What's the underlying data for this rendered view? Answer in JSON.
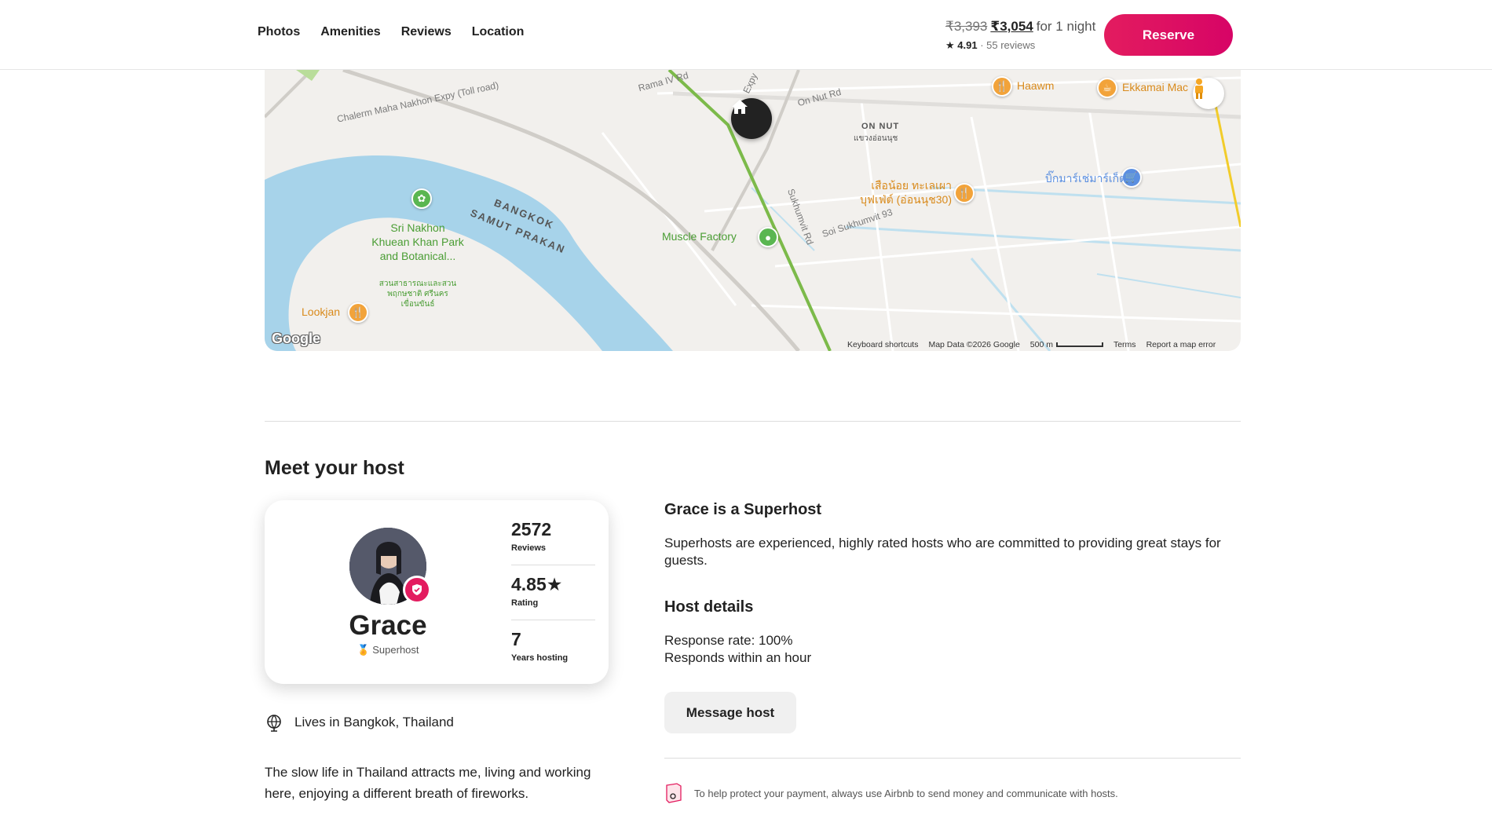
{
  "header": {
    "nav": [
      "Photos",
      "Amenities",
      "Reviews",
      "Location"
    ],
    "price_old": "₹3,393",
    "price_new": "₹3,054",
    "price_suffix": "for 1 night",
    "rating": "4.91",
    "rating_sep": " · ",
    "reviews_count": "55 reviews",
    "reserve_label": "Reserve",
    "brand_color": "#e31c5f"
  },
  "map": {
    "labels": {
      "haawm": "Haawm",
      "ekkamai": "Ekkamai Mac",
      "on_nut": "ON NUT",
      "on_nut_thai": "แขวงอ่อนนุช",
      "sri_nakhon": "Sri Nakhon Khuean Khan Park and Botanical...",
      "sri_nakhon_thai": "สวนสาธารณะและสวนพฤกษชาติ ศรีนครเขื่อนขันธ์",
      "bangkok": "BANGKOK",
      "samut": "SAMUT PRAKAN",
      "muscle": "Muscle Factory",
      "seafood": "เสือน้อย ทะเลเผา บุฟเฟ่ต์ (อ่อนนุช30)",
      "big_c": "บิ๊กมาร์เช่มาร์เก็ต",
      "lookjan": "Lookjan",
      "rama": "Rama IV Rd",
      "chalerm": "Chalerm Maha Nakhon Expy (Toll road)",
      "on_nut_rd": "On Nut Rd",
      "sukhumvit": "Sukhumvit Rd",
      "soi93": "Soi Sukhumvit 93",
      "expy": "Expy"
    },
    "google": "Google",
    "footer": {
      "shortcuts": "Keyboard shortcuts",
      "map_data": "Map Data ©2026 Google",
      "scale": "500 m",
      "terms": "Terms",
      "report": "Report a map error"
    }
  },
  "host": {
    "section_title": "Meet your host",
    "name": "Grace",
    "subtitle": "Superhost",
    "stats": [
      {
        "value": "2572",
        "label": "Reviews"
      },
      {
        "value": "4.85★",
        "label": "Rating"
      },
      {
        "value": "7",
        "label": "Years hosting"
      }
    ],
    "lives_in": "Lives in Bangkok, Thailand",
    "about": "The slow life in Thailand attracts me, living and working here, enjoying a different breath of fireworks.",
    "superhost_title": "Grace is a Superhost",
    "superhost_desc": "Superhosts are experienced, highly rated hosts who are committed to providing great stays for guests.",
    "details_title": "Host details",
    "response_rate": "Response rate: 100%",
    "responds": "Responds within an hour",
    "message_label": "Message host",
    "protect_text": "To help protect your payment, always use Airbnb to send money and communicate with hosts."
  }
}
